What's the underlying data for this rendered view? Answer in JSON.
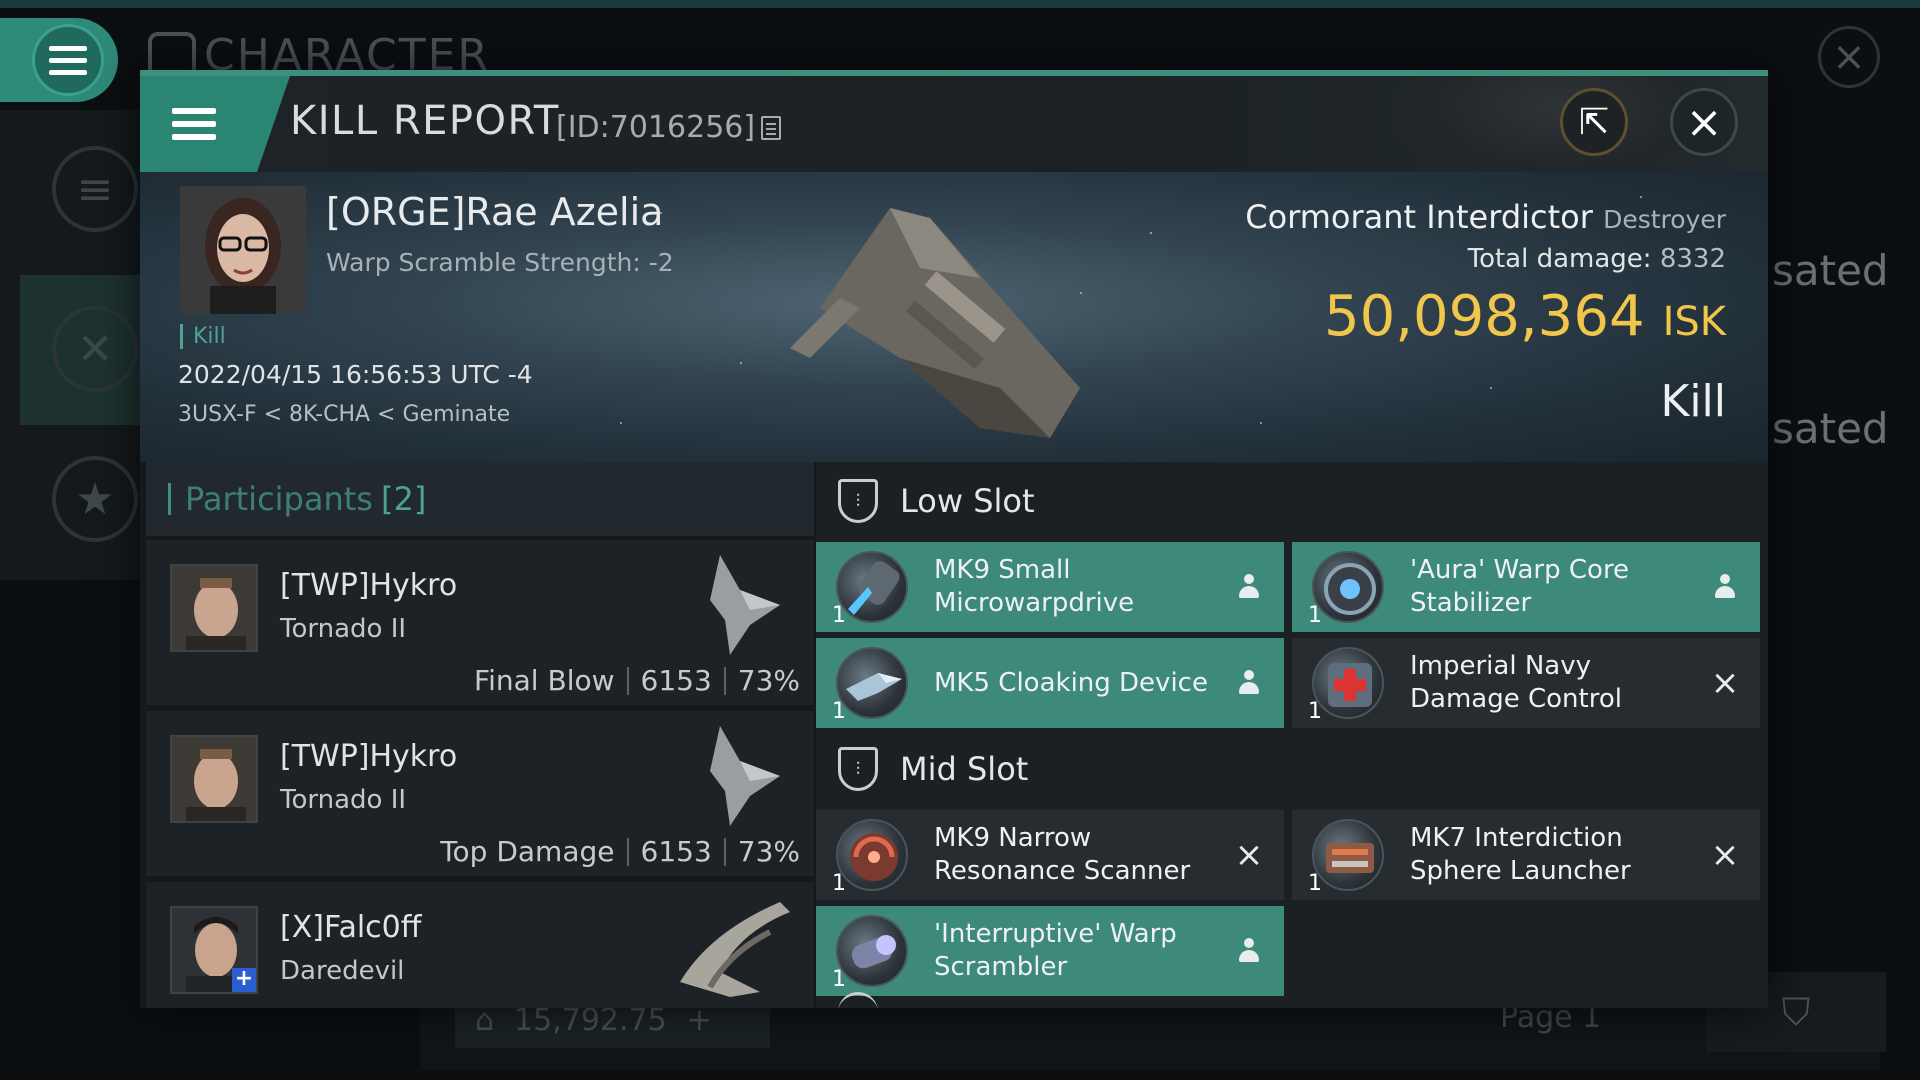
{
  "background": {
    "section_title": "CHARACTER",
    "right_texts": [
      "sated",
      "sated"
    ],
    "bottom_value": "15,792.75",
    "page_label": "Page 1"
  },
  "dialog": {
    "title": "KILL REPORT",
    "id_label": "[ID:7016256]",
    "icons": {
      "menu": "menu-icon",
      "share": "share-icon",
      "close": "close-icon",
      "copy": "copy-icon"
    }
  },
  "victim": {
    "name": "[ORGE]Rae Azelia",
    "subtitle": "Warp Scramble Strength: -2",
    "tag": "Kill",
    "datetime": "2022/04/15 16:56:53 UTC -4",
    "location": "3USX-F < 8K-CHA < Geminate",
    "ship_name": "Cormorant Interdictor",
    "ship_class": "Destroyer",
    "total_damage_label": "Total damage:",
    "total_damage": "8332",
    "isk_value": "50,098,364",
    "isk_unit": "ISK",
    "result": "Kill"
  },
  "participants": {
    "label": "Participants",
    "count": "[2]",
    "rows": [
      {
        "name": "[TWP]Hykro",
        "ship": "Tornado II",
        "role": "Final Blow",
        "damage": "6153",
        "percent": "73%"
      },
      {
        "name": "[TWP]Hykro",
        "ship": "Tornado II",
        "role": "Top Damage",
        "damage": "6153",
        "percent": "73%"
      },
      {
        "name": "[X]Falc0ff",
        "ship": "Daredevil",
        "role": "",
        "damage": "",
        "percent": ""
      }
    ]
  },
  "fitting": {
    "low_slot_label": "Low Slot",
    "mid_slot_label": "Mid Slot",
    "low": [
      {
        "name": "MK9 Small Microwarpdrive",
        "qty": "1",
        "status": "dropped"
      },
      {
        "name": "'Aura' Warp Core Stabilizer",
        "qty": "1",
        "status": "dropped"
      },
      {
        "name": "MK5 Cloaking Device",
        "qty": "1",
        "status": "dropped"
      },
      {
        "name": "Imperial Navy Damage Control",
        "qty": "1",
        "status": "destroyed"
      }
    ],
    "mid": [
      {
        "name": "MK9 Narrow Resonance Scanner",
        "qty": "1",
        "status": "destroyed"
      },
      {
        "name": "MK7 Interdiction Sphere Launcher",
        "qty": "1",
        "status": "destroyed"
      },
      {
        "name": "'Interruptive' Warp Scrambler",
        "qty": "1",
        "status": "dropped"
      }
    ]
  },
  "colors": {
    "accent": "#3d8f80",
    "dropped": "#3d8a7a",
    "isk": "#f0c64b"
  }
}
